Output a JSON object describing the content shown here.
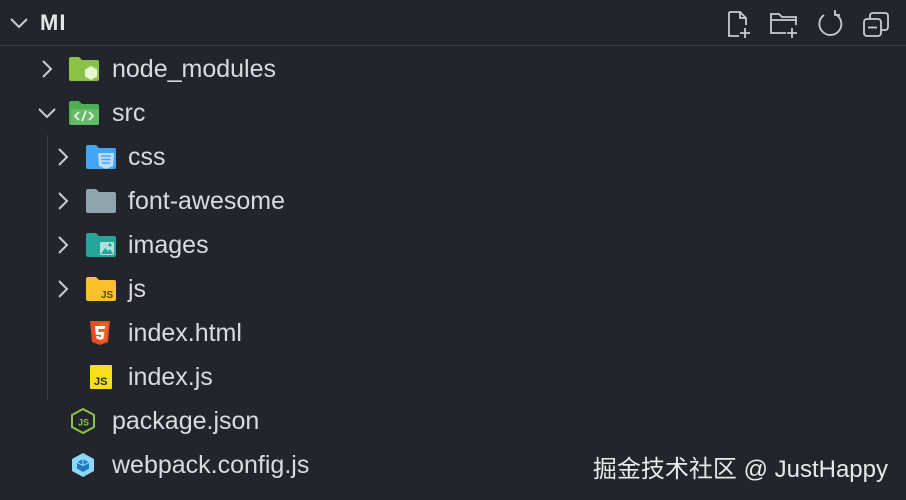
{
  "explorer": {
    "title": "MI",
    "actions": [
      {
        "name": "new-file-icon"
      },
      {
        "name": "new-folder-icon"
      },
      {
        "name": "refresh-icon"
      },
      {
        "name": "collapse-all-icon"
      }
    ]
  },
  "tree": {
    "node_modules": "node_modules",
    "src": "src",
    "css": "css",
    "font_awesome": "font-awesome",
    "images": "images",
    "js": "js",
    "index_html": "index.html",
    "index_js": "index.js",
    "package_json": "package.json",
    "webpack_config": "webpack.config.js"
  },
  "icons": {
    "node_modules": "folder-node-icon",
    "src": "folder-src-icon",
    "css": "folder-css-icon",
    "font_awesome": "folder-icon",
    "images": "folder-images-icon",
    "js": "folder-js-icon",
    "index_html": "html5-icon",
    "index_js": "javascript-icon",
    "package_json": "nodejs-icon",
    "webpack_config": "webpack-icon"
  },
  "colors": {
    "background": "#22252b",
    "node_folder": "#8bc34a",
    "src_folder": "#4caf50",
    "css_folder": "#42a5f5",
    "plain_folder": "#90a4ae",
    "images_folder": "#26a69a",
    "js_folder": "#fbc02d",
    "html": "#e44d26",
    "js_file": "#f7df1e",
    "node_file": "#8bc34a",
    "webpack": "#8ed6fb"
  },
  "watermark": "掘金技术社区 @ JustHappy"
}
